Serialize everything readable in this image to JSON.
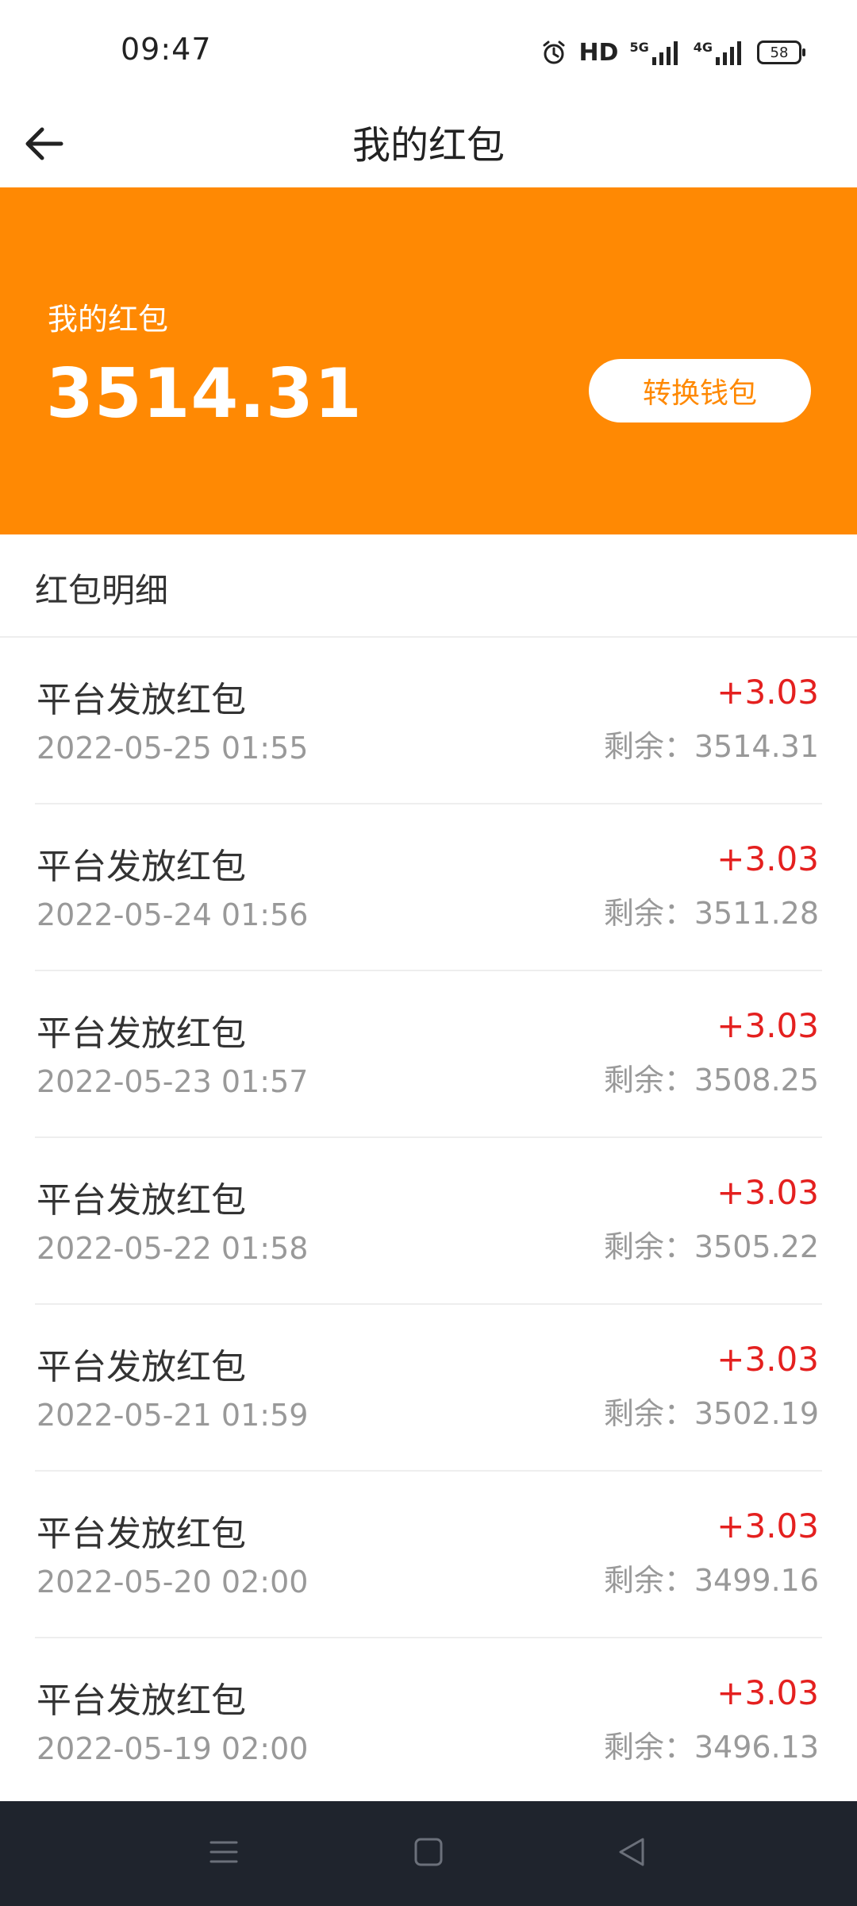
{
  "status_bar": {
    "time": "09:47",
    "hd_label": "HD",
    "signal_5g_label": "5G",
    "signal_4g_label": "4G",
    "battery": "58",
    "icons": [
      "alarm-icon",
      "hd-icon",
      "signal-5g-icon",
      "signal-4g-icon",
      "battery-icon"
    ]
  },
  "header": {
    "title": "我的红包",
    "back_icon": "arrow-left-icon"
  },
  "banner": {
    "label": "我的红包",
    "amount": "3514.31",
    "convert_button": "转换钱包",
    "background_color": "#ff8903"
  },
  "details": {
    "section_title": "红包明细",
    "items": [
      {
        "title": "平台发放红包",
        "date": "2022-05-25 01:55",
        "amount": "+3.03",
        "remain": "剩余：3514.31"
      },
      {
        "title": "平台发放红包",
        "date": "2022-05-24 01:56",
        "amount": "+3.03",
        "remain": "剩余：3511.28"
      },
      {
        "title": "平台发放红包",
        "date": "2022-05-23 01:57",
        "amount": "+3.03",
        "remain": "剩余：3508.25"
      },
      {
        "title": "平台发放红包",
        "date": "2022-05-22 01:58",
        "amount": "+3.03",
        "remain": "剩余：3505.22"
      },
      {
        "title": "平台发放红包",
        "date": "2022-05-21 01:59",
        "amount": "+3.03",
        "remain": "剩余：3502.19"
      },
      {
        "title": "平台发放红包",
        "date": "2022-05-20 02:00",
        "amount": "+3.03",
        "remain": "剩余：3499.16"
      },
      {
        "title": "平台发放红包",
        "date": "2022-05-19 02:00",
        "amount": "+3.03",
        "remain": "剩余：3496.13"
      }
    ],
    "amount_color": "#e4201f"
  },
  "nav_bar": {
    "buttons": [
      "menu-icon",
      "home-square-icon",
      "back-triangle-icon"
    ]
  }
}
